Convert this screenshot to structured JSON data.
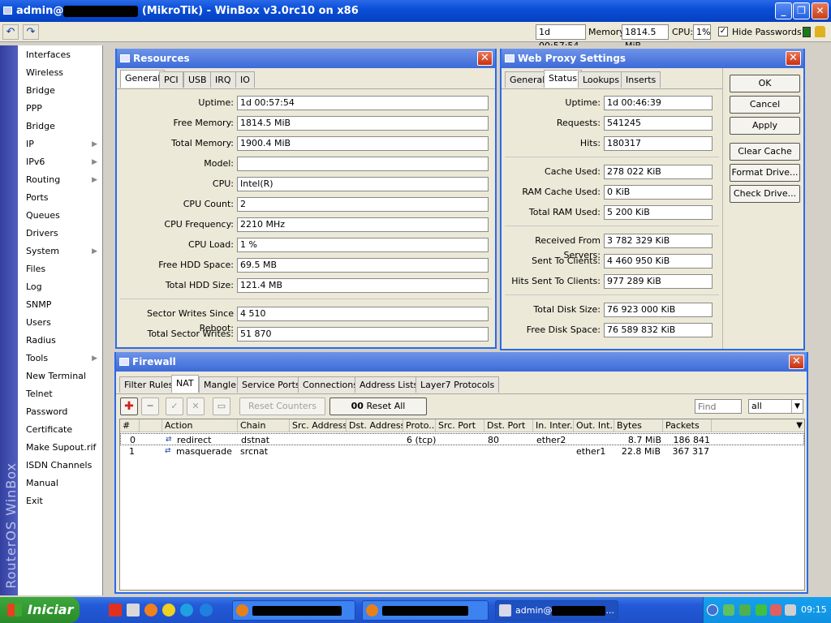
{
  "titlebar": {
    "prefix": "admin@",
    "suffix": " (MikroTik) - WinBox v3.0rc10 on x86"
  },
  "toolbar": {
    "uptime": "1d 00:57:54",
    "memory_label": "Memory:",
    "memory": "1814.5 MiB",
    "cpu_label": "CPU:",
    "cpu": "1%",
    "hide_passwords": "Hide Passwords"
  },
  "sidebar": {
    "brand": "RouterOS WinBox",
    "items": [
      "Interfaces",
      "Wireless",
      "Bridge",
      "PPP",
      "Bridge",
      "IP",
      "IPv6",
      "Routing",
      "Ports",
      "Queues",
      "Drivers",
      "System",
      "Files",
      "Log",
      "SNMP",
      "Users",
      "Radius",
      "Tools",
      "New Terminal",
      "Telnet",
      "Password",
      "Certificate",
      "Make Supout.rif",
      "ISDN Channels",
      "Manual",
      "Exit"
    ]
  },
  "resources": {
    "title": "Resources",
    "tabs": [
      "General",
      "PCI",
      "USB",
      "IRQ",
      "IO"
    ],
    "fields": [
      {
        "label": "Uptime:",
        "value": "1d 00:57:54"
      },
      {
        "label": "Free Memory:",
        "value": "1814.5 MiB"
      },
      {
        "label": "Total Memory:",
        "value": "1900.4 MiB"
      },
      {
        "label": "Model:",
        "value": ""
      },
      {
        "label": "CPU:",
        "value": "Intel(R)"
      },
      {
        "label": "CPU Count:",
        "value": "2"
      },
      {
        "label": "CPU Frequency:",
        "value": "2210 MHz"
      },
      {
        "label": "CPU Load:",
        "value": "1 %"
      },
      {
        "label": "Free HDD Space:",
        "value": "69.5 MB"
      },
      {
        "label": "Total HDD Size:",
        "value": "121.4 MB"
      },
      {
        "label": "Sector Writes Since Reboot:",
        "value": "4 510"
      },
      {
        "label": "Total Sector Writes:",
        "value": "51 870"
      }
    ]
  },
  "proxy": {
    "title": "Web Proxy Settings",
    "tabs": [
      "General",
      "Status",
      "Lookups",
      "Inserts"
    ],
    "fields": [
      {
        "label": "Uptime:",
        "value": "1d 00:46:39"
      },
      {
        "label": "Requests:",
        "value": "541245"
      },
      {
        "label": "Hits:",
        "value": "180317"
      },
      {
        "label": "Cache Used:",
        "value": "278 022 KiB"
      },
      {
        "label": "RAM Cache Used:",
        "value": "0 KiB"
      },
      {
        "label": "Total RAM Used:",
        "value": "5 200 KiB"
      },
      {
        "label": "Received From Servers:",
        "value": "3 782 329 KiB"
      },
      {
        "label": "Sent To Clients:",
        "value": "4 460 950 KiB"
      },
      {
        "label": "Hits Sent To Clients:",
        "value": "977 289 KiB"
      },
      {
        "label": "Total Disk Size:",
        "value": "76 923 000 KiB"
      },
      {
        "label": "Free Disk Space:",
        "value": "76 589 832 KiB"
      }
    ],
    "buttons": [
      "OK",
      "Cancel",
      "Apply",
      "Clear Cache",
      "Format Drive...",
      "Check Drive..."
    ]
  },
  "firewall": {
    "title": "Firewall",
    "tabs": [
      "Filter Rules",
      "NAT",
      "Mangle",
      "Service Ports",
      "Connections",
      "Address Lists",
      "Layer7 Protocols"
    ],
    "reset_counters": "Reset Counters",
    "reset_all_prefix": "00",
    "reset_all": "Reset All Counters",
    "find_placeholder": "Find",
    "filter_value": "all",
    "columns": [
      "#",
      "",
      "Action",
      "Chain",
      "Src. Address",
      "Dst. Address",
      "Proto...",
      "Src. Port",
      "Dst. Port",
      "In. Inter...",
      "Out. Int...",
      "Bytes",
      "Packets"
    ],
    "rows": [
      [
        "0",
        "",
        "redirect",
        "dstnat",
        "",
        "",
        "6 (tcp)",
        "",
        "80",
        "ether2",
        "",
        "8.7 MiB",
        "186 841"
      ],
      [
        "1",
        "",
        "masquerade",
        "srcnat",
        "",
        "",
        "",
        "",
        "",
        "",
        "ether1",
        "22.8 MiB",
        "367 317"
      ]
    ]
  },
  "taskbar": {
    "start": "Iniciar",
    "task3_prefix": "admin@",
    "task3_suffix": "...",
    "time": "09:15"
  }
}
